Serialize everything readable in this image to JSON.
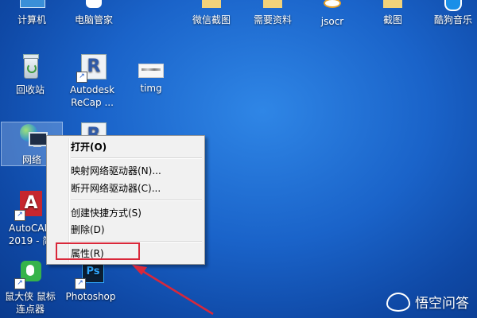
{
  "desktop_icons": {
    "computer": "计算机",
    "pc_manager": "电脑管家",
    "wechat_screenshot": "微信截图",
    "needed_materials": "需要资料",
    "jsocr": "jsocr",
    "screenshot": "截图",
    "kugou": "酷狗音乐",
    "recycle_bin": "回收站",
    "autodesk_recap_line1": "Autodesk",
    "autodesk_recap_line2": "ReCap ...",
    "timg": "timg",
    "network": "网络",
    "autocad_line1": "AutoCAD",
    "autocad_line2": "2019 - 简",
    "mouse_line1": "鼠大侠 鼠标",
    "mouse_line2": "连点器",
    "photoshop": "Photoshop"
  },
  "context_menu": {
    "open": "打开(O)",
    "map_drive": "映射网络驱动器(N)...",
    "disconnect_drive": "断开网络驱动器(C)...",
    "create_shortcut": "创建快捷方式(S)",
    "delete": "删除(D)",
    "properties": "属性(R)"
  },
  "watermark": {
    "text": "悟空问答"
  },
  "colors": {
    "desktop": "#1a63c9",
    "highlight_box": "#d9283a",
    "arrow": "#d9283a"
  }
}
